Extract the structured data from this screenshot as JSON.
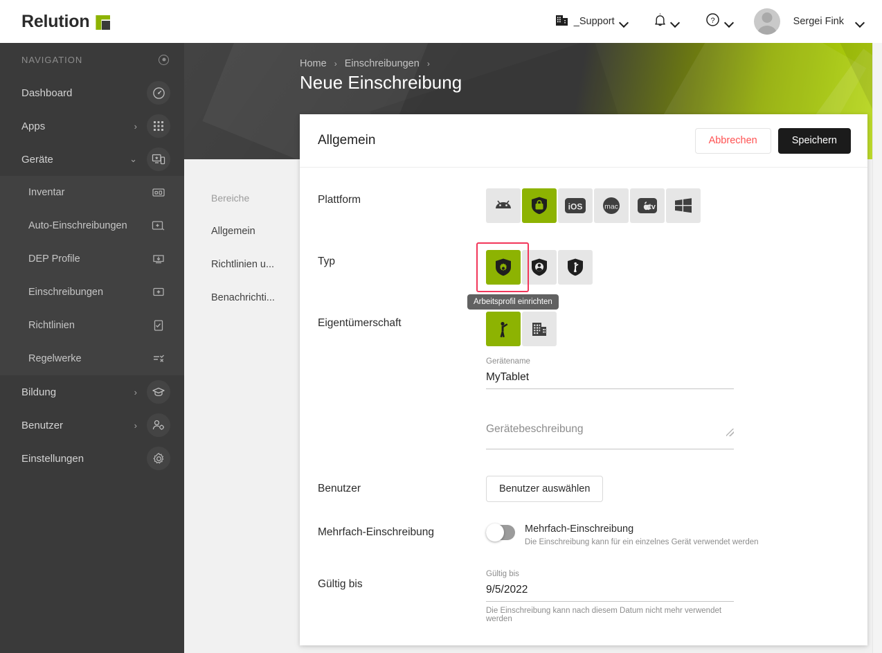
{
  "brand": {
    "name": "Relution",
    "logo_icon": "relution-flag-logo"
  },
  "topbar": {
    "org": {
      "label": "_Support",
      "icon": "building-icon",
      "chevron": "chevron-down-icon"
    },
    "notifications": {
      "icon": "bell-icon",
      "chevron": "chevron-down-icon"
    },
    "help": {
      "icon": "question-circle-icon",
      "chevron": "chevron-down-icon"
    },
    "user": {
      "name": "Sergei Fink",
      "avatar_icon": "avatar-icon",
      "chevron": "chevron-down-icon"
    }
  },
  "sidebar": {
    "heading": "NAVIGATION",
    "heading_icon": "target-icon",
    "items": [
      {
        "label": "Dashboard",
        "icon": "speedometer-icon",
        "arrow": "",
        "level": "top"
      },
      {
        "label": "Apps",
        "icon": "grid-apps-icon",
        "arrow": "›",
        "level": "top"
      },
      {
        "label": "Geräte",
        "icon": "devices-icon",
        "arrow": "⌄",
        "level": "top",
        "expanded": true
      },
      {
        "label": "Inventar",
        "icon": "inventory-icon",
        "arrow": "",
        "level": "sub"
      },
      {
        "label": "Auto-Einschreibungen",
        "icon": "auto-enroll-icon",
        "arrow": "",
        "level": "sub"
      },
      {
        "label": "DEP Profile",
        "icon": "dep-download-icon",
        "arrow": "",
        "level": "sub"
      },
      {
        "label": "Einschreibungen",
        "icon": "enroll-plus-icon",
        "arrow": "",
        "level": "sub"
      },
      {
        "label": "Richtlinien",
        "icon": "policy-icon",
        "arrow": "",
        "level": "sub"
      },
      {
        "label": "Regelwerke",
        "icon": "rules-icon",
        "arrow": "",
        "level": "sub"
      },
      {
        "label": "Bildung",
        "icon": "graduation-cap-icon",
        "arrow": "›",
        "level": "top"
      },
      {
        "label": "Benutzer",
        "icon": "user-settings-icon",
        "arrow": "›",
        "level": "top"
      },
      {
        "label": "Einstellungen",
        "icon": "gear-icon",
        "arrow": "",
        "level": "top"
      }
    ]
  },
  "breadcrumb": {
    "items": [
      "Home",
      "Einschreibungen"
    ],
    "separator": "›",
    "trailing_separator": "›"
  },
  "page": {
    "title": "Neue Einschreibung"
  },
  "subnav": {
    "heading": "Bereiche",
    "items": [
      "Allgemein",
      "Richtlinien u...",
      "Benachrichti..."
    ]
  },
  "card": {
    "title": "Allgemein",
    "cancel_label": "Abbrechen",
    "save_label": "Speichern",
    "accent_cancel_color": "#ff5252",
    "accent_green": "#8db302"
  },
  "form": {
    "platform": {
      "label": "Plattform",
      "options": [
        {
          "name": "android",
          "icon": "android-head-icon",
          "selected": false
        },
        {
          "name": "android-enterprise",
          "icon": "shield-briefcase-icon",
          "selected": true
        },
        {
          "name": "ios",
          "icon": "ios-icon",
          "label": "iOS",
          "selected": false
        },
        {
          "name": "macos",
          "icon": "mac-icon",
          "label": "mac",
          "selected": false
        },
        {
          "name": "tvos",
          "icon": "apple-tv-icon",
          "label": "tv",
          "selected": false
        },
        {
          "name": "windows",
          "icon": "windows-icon",
          "selected": false
        }
      ]
    },
    "type": {
      "label": "Typ",
      "options": [
        {
          "name": "work-profile",
          "icon": "shield-gear-icon",
          "selected": true,
          "highlighted": true
        },
        {
          "name": "fully-managed",
          "icon": "shield-person-icon",
          "selected": false
        },
        {
          "name": "dedicated-device",
          "icon": "shield-kiosk-icon",
          "selected": false
        }
      ],
      "tooltip": "Arbeitsprofil einrichten"
    },
    "ownership": {
      "label": "Eigentümerschaft",
      "options": [
        {
          "name": "personal",
          "icon": "person-waving-icon",
          "selected": true
        },
        {
          "name": "company",
          "icon": "building-icon",
          "selected": false
        }
      ]
    },
    "device_name": {
      "label": "Gerätename",
      "value": "MyTablet"
    },
    "device_description": {
      "label": "Gerätebeschreibung",
      "value": "",
      "placeholder": "Gerätebeschreibung"
    },
    "user": {
      "label": "Benutzer",
      "button_label": "Benutzer auswählen"
    },
    "multi_enrollment": {
      "label": "Mehrfach-Einschreibung",
      "toggle_label": "Mehrfach-Einschreibung",
      "toggle_state": "off",
      "hint": "Die Einschreibung kann für ein einzelnes Gerät verwendet werden"
    },
    "valid_until": {
      "label": "Gültig bis",
      "field_label": "Gültig bis",
      "value": "9/5/2022",
      "hint": "Die Einschreibung kann nach diesem Datum nicht mehr verwendet werden"
    }
  }
}
